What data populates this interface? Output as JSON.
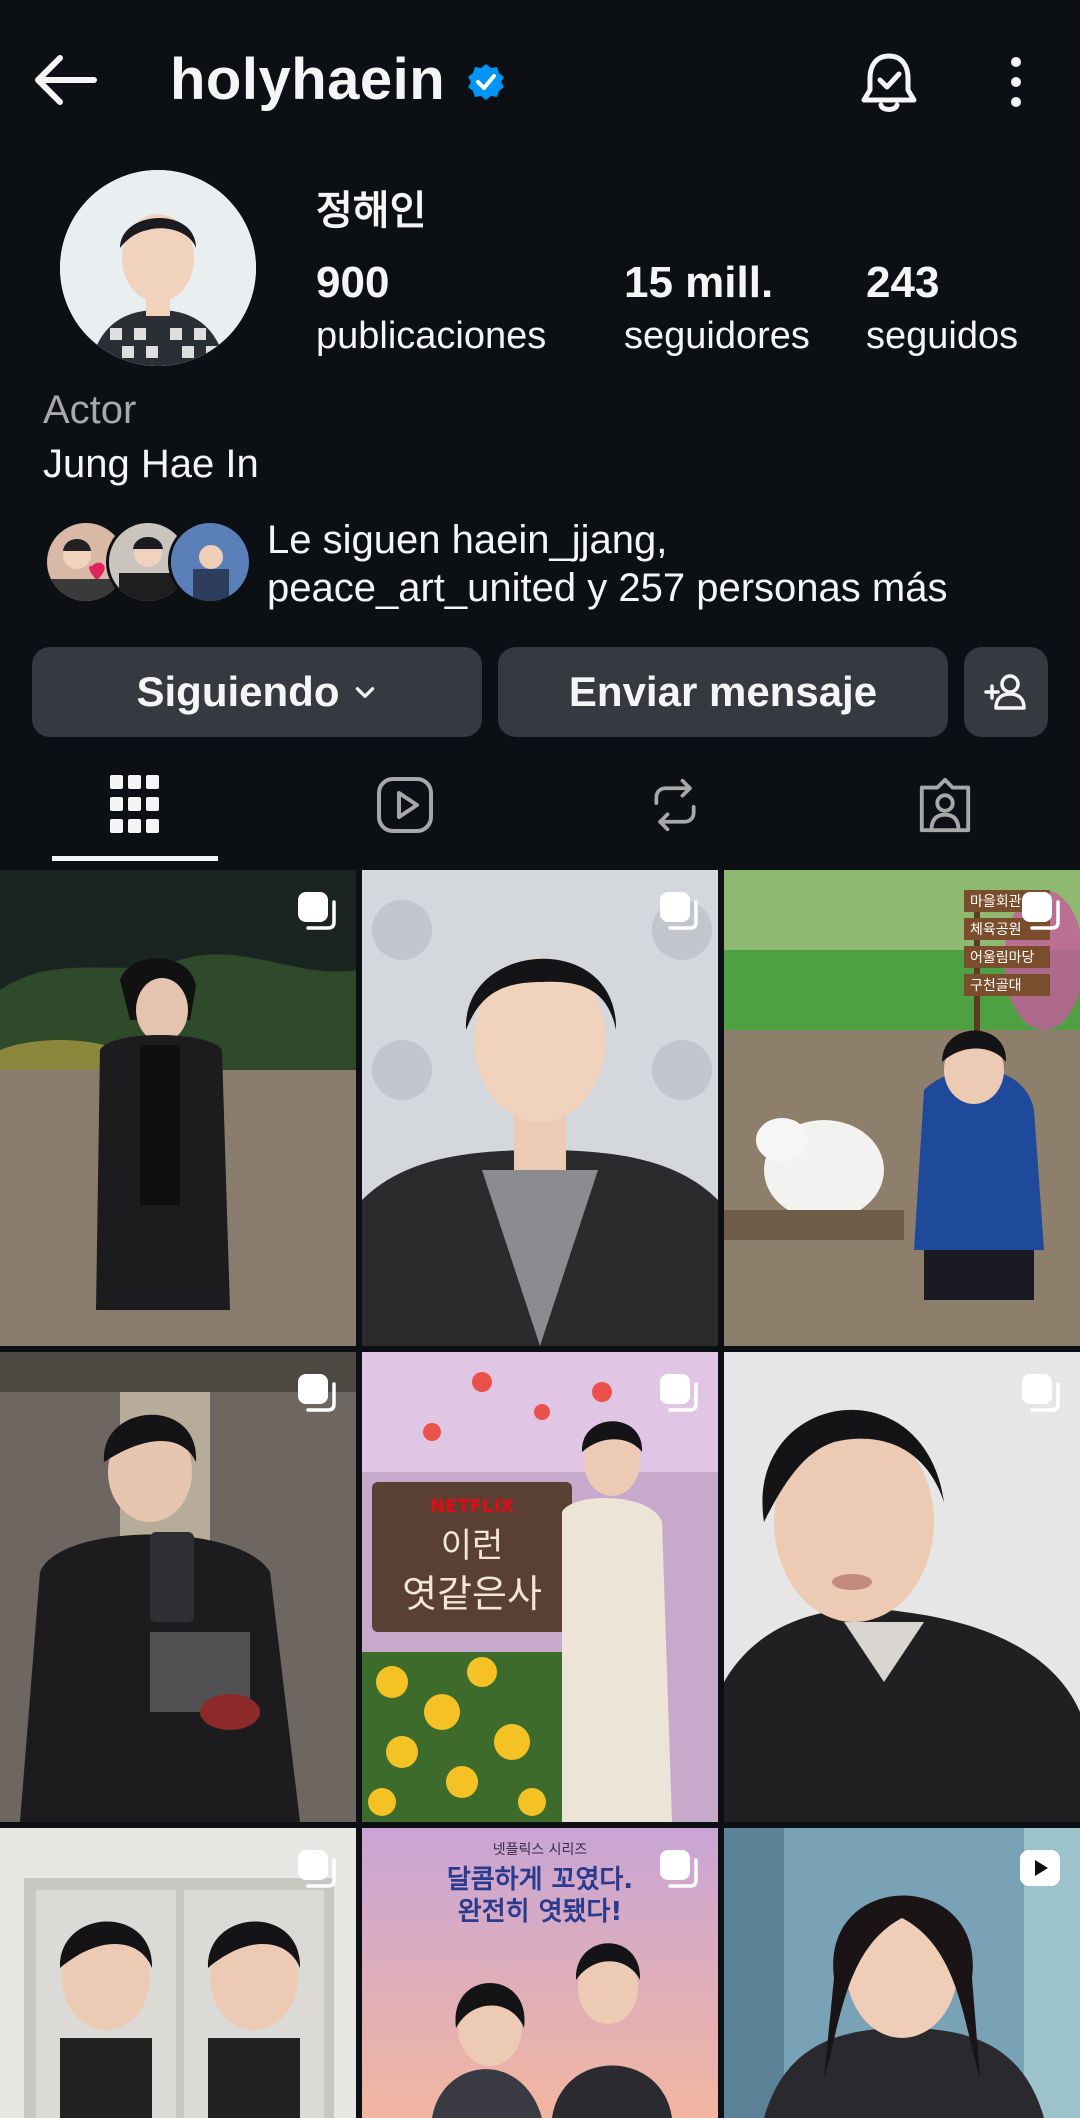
{
  "header": {
    "username": "holyhaein",
    "verified": true,
    "icons": [
      "back-arrow-icon",
      "verified-badge-icon",
      "notification-bell-icon",
      "more-options-icon"
    ]
  },
  "profile": {
    "full_name": "정해인",
    "stats": [
      {
        "number": "900",
        "label": "publicaciones"
      },
      {
        "number": "15 mill.",
        "label": "seguidores"
      },
      {
        "number": "243",
        "label": "seguidos"
      }
    ],
    "category": "Actor",
    "bio": "Jung Hae In",
    "followed_by_line1": "Le siguen haein_jjang,",
    "followed_by_line2": "peace_art_united y 257 personas más"
  },
  "actions": {
    "following_label": "Siguiendo",
    "message_label": "Enviar mensaje"
  },
  "tabs": [
    "grid-icon",
    "reels-icon",
    "reposts-icon",
    "tagged-icon"
  ],
  "posts": [
    {
      "type": "carousel",
      "overlay_text": []
    },
    {
      "type": "carousel",
      "overlay_text": []
    },
    {
      "type": "carousel",
      "overlay_text": [
        "마을회관",
        "체육공원",
        "어울림마당",
        "구천골대"
      ]
    },
    {
      "type": "carousel",
      "overlay_text": []
    },
    {
      "type": "carousel",
      "overlay_text": [
        "NETFLIX",
        "이런",
        "엿같은사"
      ]
    },
    {
      "type": "carousel",
      "overlay_text": []
    },
    {
      "type": "carousel",
      "overlay_text": []
    },
    {
      "type": "carousel",
      "overlay_text": [
        "넷플릭스 시리즈",
        "달콤하게 꼬였다.",
        "완전히 엿됐다!"
      ]
    },
    {
      "type": "reel",
      "overlay_text": []
    }
  ],
  "colors": {
    "background": "#0c1014",
    "button": "#363a40",
    "verified": "#0095f6",
    "secondary_text": "#a8a8a8"
  }
}
